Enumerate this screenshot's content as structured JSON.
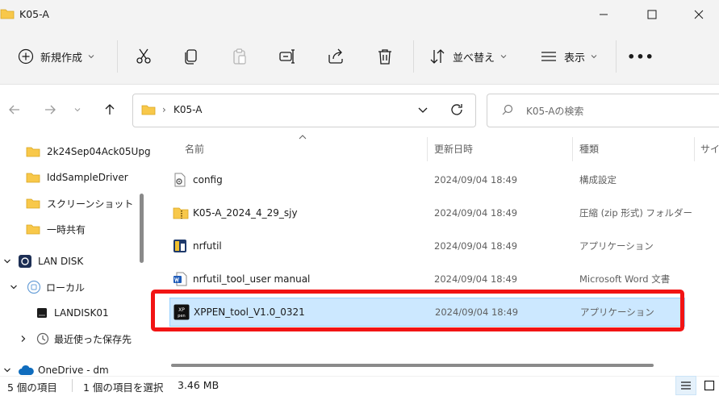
{
  "window": {
    "title": "K05-A"
  },
  "toolbar": {
    "new_label": "新規作成",
    "sort_label": "並べ替え",
    "view_label": "表示",
    "more_label": "•••"
  },
  "address": {
    "path": [
      "K05-A"
    ],
    "search_placeholder": "K05-Aの検索"
  },
  "nav": {
    "items": [
      {
        "label": "2k24Sep04Ack05Upg"
      },
      {
        "label": "IddSampleDriver"
      },
      {
        "label": "スクリーンショット"
      },
      {
        "label": "一時共有"
      },
      {
        "label": "LAN DISK"
      },
      {
        "label": "ローカル"
      },
      {
        "label": "LANDISK01"
      },
      {
        "label": "最近使った保存先"
      },
      {
        "label": "OneDrive - dm"
      }
    ]
  },
  "columns": {
    "name": "名前",
    "modified": "更新日時",
    "type": "種類",
    "size": "サイズ"
  },
  "files": [
    {
      "name": "config",
      "modified": "2024/09/04 18:49",
      "type": "構成設定",
      "icon": "config-file-icon"
    },
    {
      "name": "K05-A_2024_4_29_sjy",
      "modified": "2024/09/04 18:49",
      "type": "圧縮 (zip 形式) フォルダー",
      "icon": "zip-folder-icon"
    },
    {
      "name": "nrfutil",
      "modified": "2024/09/04 18:49",
      "type": "アプリケーション",
      "icon": "app-icon"
    },
    {
      "name": "nrfutil_tool_user manual",
      "modified": "2024/09/04 18:49",
      "type": "Microsoft Word 文書",
      "icon": "word-doc-icon"
    },
    {
      "name": "XPPEN_tool_V1.0_0321",
      "modified": "2024/09/04 18:49",
      "type": "アプリケーション",
      "icon": "xppen-app-icon",
      "selected": true
    }
  ],
  "status": {
    "count": "5 個の項目",
    "selection": "1 個の項目を選択",
    "size": "3.46 MB"
  },
  "colors": {
    "selection": "#cce8ff",
    "highlight": "#f21414",
    "folder": "#f8c84a"
  }
}
